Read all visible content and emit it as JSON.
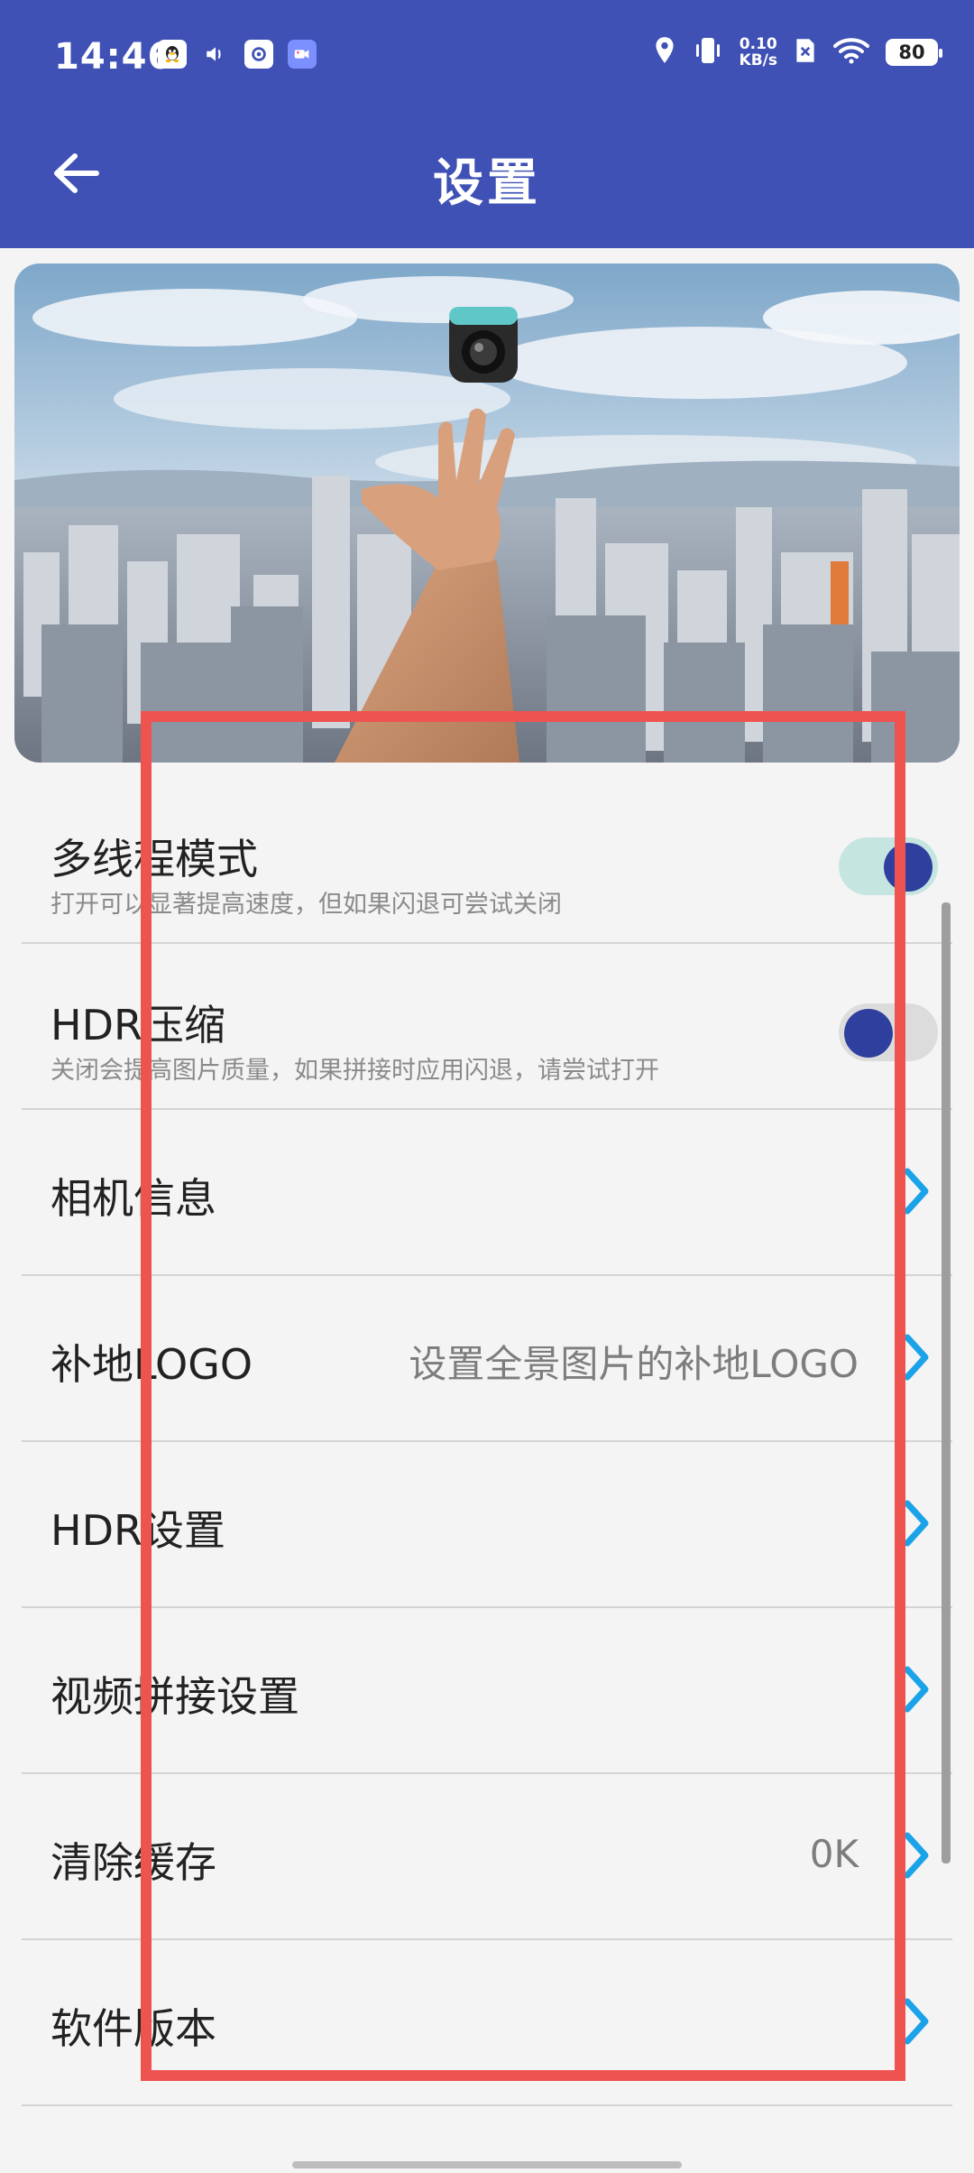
{
  "status_bar": {
    "time": "14:46",
    "net_speed_value": "0.10",
    "net_speed_unit": "KB/s",
    "battery": "80",
    "left_icons": [
      "qq-icon",
      "volume-icon",
      "app-icon",
      "video-icon"
    ],
    "right_icons": [
      "location-icon",
      "vibrate-icon",
      "no-sim-icon",
      "wifi-icon"
    ]
  },
  "app_bar": {
    "title": "设置",
    "back_icon": "arrow-left-icon"
  },
  "banner": {
    "image": "hand-tossing-360-camera-over-city"
  },
  "settings": {
    "items": [
      {
        "title": "多线程模式",
        "subtitle": "打开可以显著提高速度，但如果闪退可尝试关闭",
        "control": "toggle",
        "toggle_state": "on"
      },
      {
        "title": "HDR压缩",
        "subtitle": "关闭会提高图片质量，如果拼接时应用闪退，请尝试打开",
        "control": "toggle",
        "toggle_state": "off"
      },
      {
        "title": "相机信息",
        "control": "chevron"
      },
      {
        "title": "补地LOGO",
        "value": "设置全景图片的补地LOGO",
        "control": "chevron"
      },
      {
        "title": "HDR设置",
        "control": "chevron"
      },
      {
        "title": "视频拼接设置",
        "control": "chevron"
      },
      {
        "title": "清除缓存",
        "value": "0K",
        "control": "chevron"
      },
      {
        "title": "软件版本",
        "control": "chevron"
      }
    ]
  },
  "colors": {
    "app_bar": "#3f51b5",
    "toggle_knob": "#2e3f9e",
    "toggle_track_on": "#c5e5e1",
    "chevron": "#1aa3e8",
    "highlight_box": "#ef5350"
  }
}
